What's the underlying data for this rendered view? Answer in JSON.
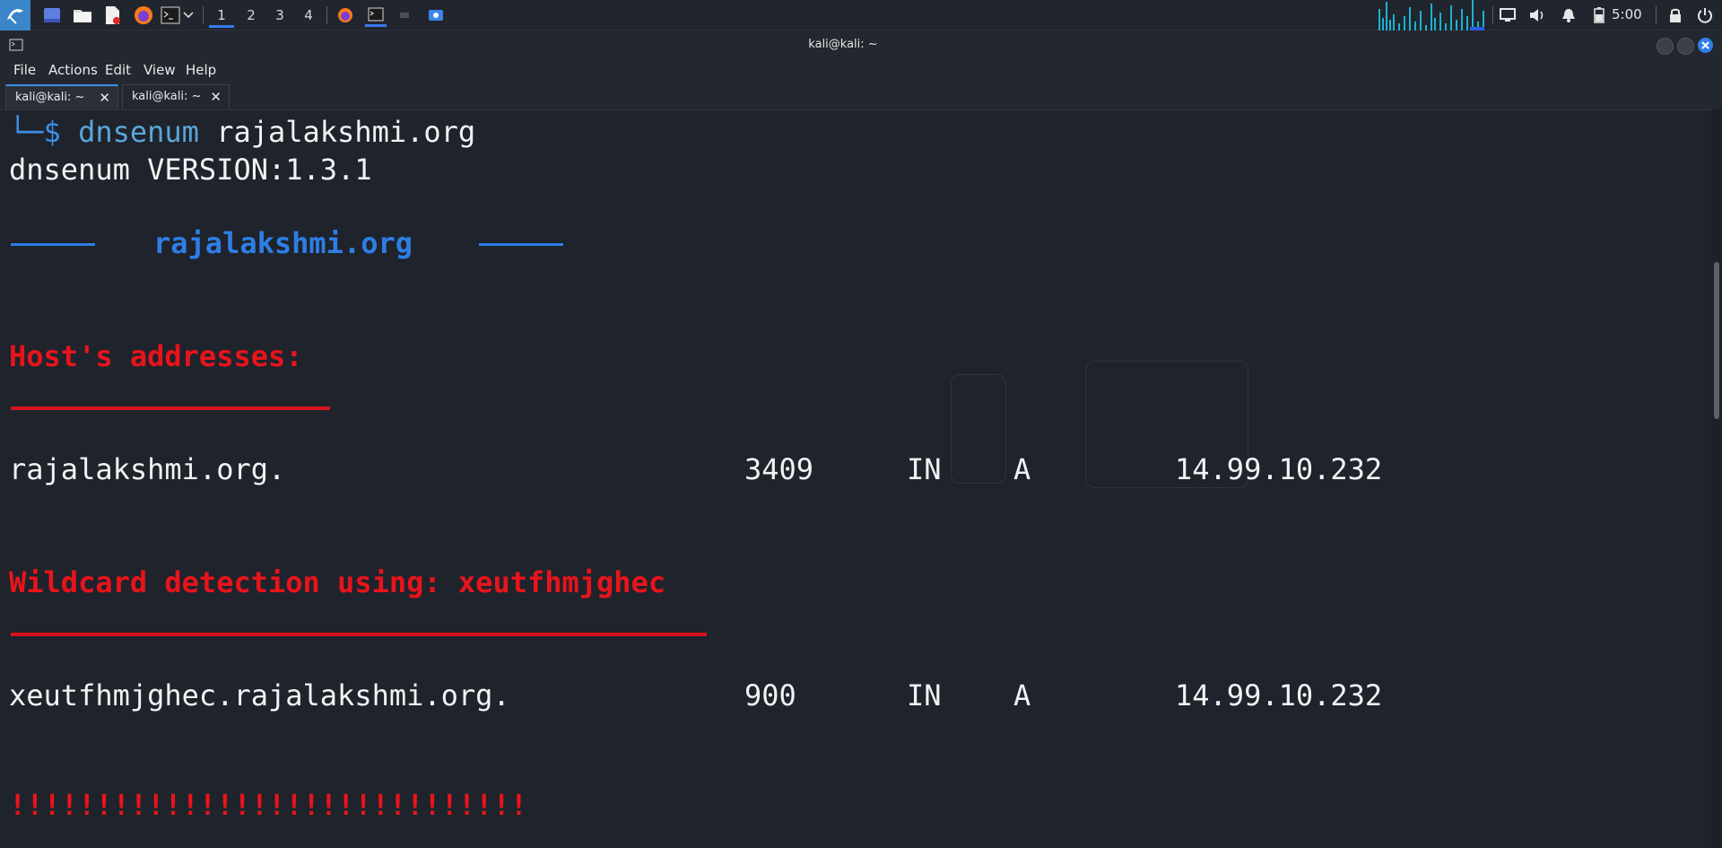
{
  "panel": {
    "workspaces": [
      "1",
      "2",
      "3",
      "4"
    ],
    "active_workspace": "1",
    "clock": "5:00",
    "icons": [
      "kali-menu-icon",
      "show-desktop-icon",
      "file-manager-icon",
      "text-editor-icon",
      "firefox-icon",
      "terminal-icon",
      "dropdown-chevron-icon",
      "network-graph-icon",
      "display-icon",
      "volume-icon",
      "notification-bell-icon",
      "battery-icon",
      "lock-icon",
      "power-icon"
    ]
  },
  "window": {
    "title": "kali@kali: ~"
  },
  "menubar": {
    "file": "File",
    "actions": "Actions",
    "edit": "Edit",
    "view": "View",
    "help": "Help"
  },
  "tabs": [
    {
      "label": "kali@kali: ~",
      "active": true
    },
    {
      "label": "kali@kali: ~",
      "active": false
    }
  ],
  "terminal": {
    "prompt_prefix": "└─$ ",
    "command": "dnsenum",
    "command_args": " rajalakshmi.org",
    "version_line": "dnsenum VERSION:1.3.1",
    "domain_header": "rajalakshmi.org",
    "section_hosts": "Host's addresses:",
    "hosts": [
      {
        "name": "rajalakshmi.org.",
        "ttl": "3409",
        "class": "IN",
        "type": "A",
        "address": "14.99.10.232"
      }
    ],
    "section_wildcard": "Wildcard detection using: xeutfhmjghec",
    "wildcard": [
      {
        "name": "xeutfhmjghec.rajalakshmi.org.",
        "ttl": "900",
        "class": "IN",
        "type": "A",
        "address": "14.99.10.232"
      }
    ],
    "bangs": "!!!!!!!!!!!!!!!!!!!!!!!!!!!!!!"
  },
  "colors": {
    "accent_blue": "#367bf0",
    "heading_red": "#e8141a",
    "command_cyan": "#5aa6d8",
    "background": "#1f232c"
  }
}
